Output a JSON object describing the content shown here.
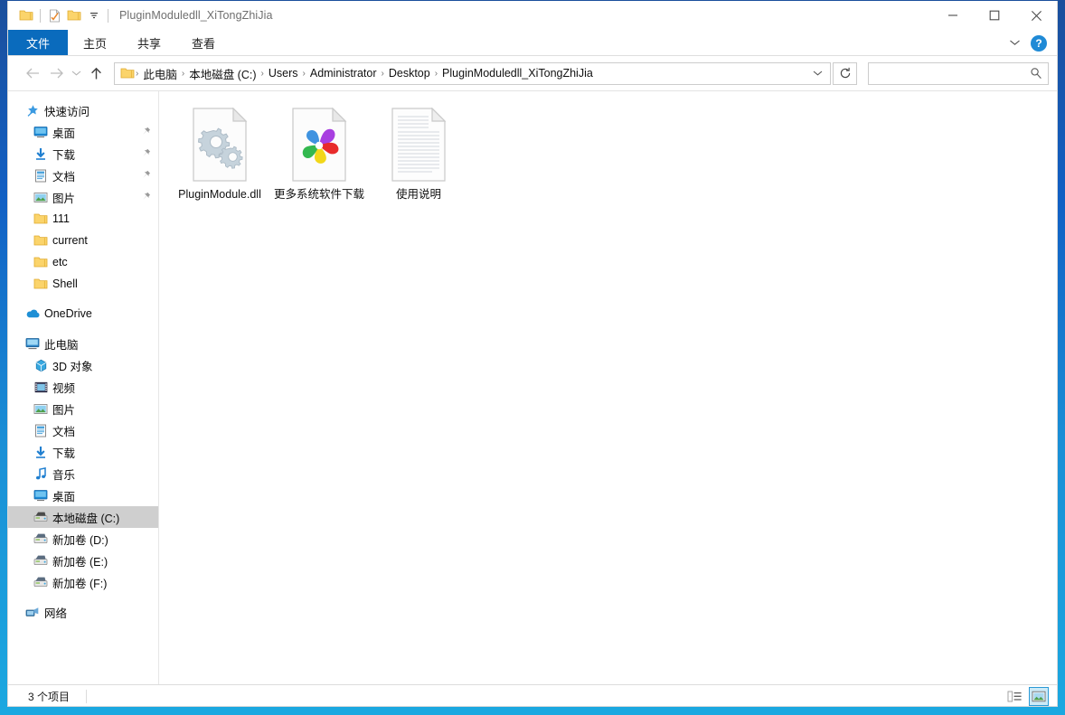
{
  "window": {
    "title": "PluginModuledll_XiTongZhiJia",
    "minimize_label": "─",
    "maximize_label": "☐",
    "close_label": "✕"
  },
  "quick_access_toolbar": {
    "items": [
      {
        "name": "folder-icon",
        "label": ""
      },
      {
        "name": "properties-icon",
        "label": ""
      },
      {
        "name": "new-folder-icon",
        "label": ""
      },
      {
        "name": "customize-dropdown-icon",
        "label": ""
      }
    ]
  },
  "ribbon": {
    "tabs": [
      {
        "label": "文件",
        "active": true
      },
      {
        "label": "主页",
        "active": false
      },
      {
        "label": "共享",
        "active": false
      },
      {
        "label": "查看",
        "active": false
      }
    ],
    "collapse_icon": "chevron-down-icon",
    "help_label": "?"
  },
  "navbar": {
    "back_icon": "arrow-left-icon",
    "forward_icon": "arrow-right-icon",
    "recent_icon": "chevron-down-icon",
    "up_icon": "arrow-up-icon",
    "breadcrumbs": [
      "此电脑",
      "本地磁盘 (C:)",
      "Users",
      "Administrator",
      "Desktop",
      "PluginModuledll_XiTongZhiJia"
    ],
    "separator": "›",
    "address_dropdown_icon": "chevron-down-icon",
    "refresh_icon": "refresh-icon",
    "search": {
      "value": "",
      "placeholder": "",
      "icon": "search-icon"
    }
  },
  "sidebar": {
    "groups": [
      {
        "name": "quick-access",
        "header": {
          "label": "快速访问",
          "icon": "star-pin-icon"
        },
        "items": [
          {
            "label": "桌面",
            "icon": "desktop-icon",
            "pinned": true
          },
          {
            "label": "下载",
            "icon": "downloads-icon",
            "pinned": true
          },
          {
            "label": "文档",
            "icon": "documents-icon",
            "pinned": true
          },
          {
            "label": "图片",
            "icon": "pictures-icon",
            "pinned": true
          },
          {
            "label": "111",
            "icon": "folder-icon",
            "pinned": false
          },
          {
            "label": "current",
            "icon": "folder-icon",
            "pinned": false
          },
          {
            "label": "etc",
            "icon": "folder-icon",
            "pinned": false
          },
          {
            "label": "Shell",
            "icon": "folder-icon",
            "pinned": false
          }
        ]
      },
      {
        "name": "onedrive",
        "header": {
          "label": "OneDrive",
          "icon": "cloud-icon"
        },
        "items": []
      },
      {
        "name": "this-pc",
        "header": {
          "label": "此电脑",
          "icon": "computer-icon"
        },
        "items": [
          {
            "label": "3D 对象",
            "icon": "3d-objects-icon",
            "pinned": false
          },
          {
            "label": "视频",
            "icon": "videos-icon",
            "pinned": false
          },
          {
            "label": "图片",
            "icon": "pictures-icon",
            "pinned": false
          },
          {
            "label": "文档",
            "icon": "documents-icon",
            "pinned": false
          },
          {
            "label": "下载",
            "icon": "downloads-icon",
            "pinned": false
          },
          {
            "label": "音乐",
            "icon": "music-icon",
            "pinned": false
          },
          {
            "label": "桌面",
            "icon": "desktop-icon",
            "pinned": false
          },
          {
            "label": "本地磁盘 (C:)",
            "icon": "system-drive-icon",
            "pinned": false,
            "selected": true
          },
          {
            "label": "新加卷 (D:)",
            "icon": "drive-icon",
            "pinned": false
          },
          {
            "label": "新加卷 (E:)",
            "icon": "drive-icon",
            "pinned": false
          },
          {
            "label": "新加卷 (F:)",
            "icon": "drive-icon",
            "pinned": false
          }
        ]
      },
      {
        "name": "network",
        "header": {
          "label": "网络",
          "icon": "network-icon"
        },
        "items": []
      }
    ]
  },
  "files": [
    {
      "name": "PluginModule.dll",
      "icon": "dll-gears-icon"
    },
    {
      "name": "更多系统软件下载",
      "icon": "pinwheel-shortcut-icon"
    },
    {
      "name": "使用说明",
      "icon": "text-document-icon"
    }
  ],
  "statusbar": {
    "item_count_label": "3 个项目",
    "views": [
      {
        "name": "details-view",
        "active": false
      },
      {
        "name": "large-icons-view",
        "active": true
      }
    ]
  },
  "colors": {
    "accent": "#0a6bbd",
    "frame_top": "#1b4f9c",
    "frame_bottom": "#1ba8e0",
    "selection": "#cfcfcf",
    "help_blue": "#1f8ad6"
  }
}
